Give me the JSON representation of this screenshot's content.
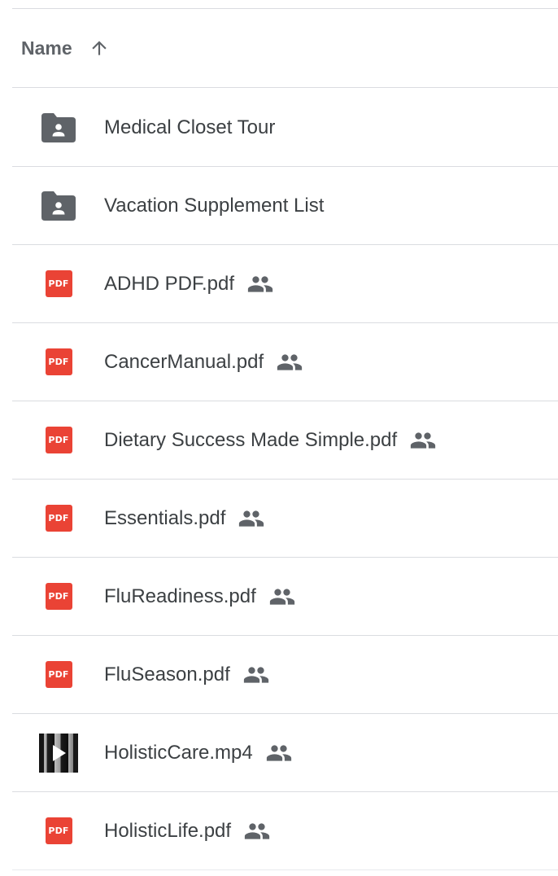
{
  "header": {
    "name_label": "Name",
    "sort_icon": "arrow-up-icon"
  },
  "files": [
    {
      "name": "Medical Closet Tour",
      "type": "shared-folder",
      "icon": "shared-folder-icon",
      "shared": false
    },
    {
      "name": "Vacation Supplement List",
      "type": "shared-folder",
      "icon": "shared-folder-icon",
      "shared": false
    },
    {
      "name": "ADHD PDF.pdf",
      "type": "pdf",
      "icon": "pdf-icon",
      "icon_text": "PDF",
      "shared": true
    },
    {
      "name": "CancerManual.pdf",
      "type": "pdf",
      "icon": "pdf-icon",
      "icon_text": "PDF",
      "shared": true
    },
    {
      "name": "Dietary Success Made Simple.pdf",
      "type": "pdf",
      "icon": "pdf-icon",
      "icon_text": "PDF",
      "shared": true
    },
    {
      "name": "Essentials.pdf",
      "type": "pdf",
      "icon": "pdf-icon",
      "icon_text": "PDF",
      "shared": true
    },
    {
      "name": "FluReadiness.pdf",
      "type": "pdf",
      "icon": "pdf-icon",
      "icon_text": "PDF",
      "shared": true
    },
    {
      "name": "FluSeason.pdf",
      "type": "pdf",
      "icon": "pdf-icon",
      "icon_text": "PDF",
      "shared": true
    },
    {
      "name": "HolisticCare.mp4",
      "type": "video",
      "icon": "video-thumbnail-icon",
      "shared": true
    },
    {
      "name": "HolisticLife.pdf",
      "type": "pdf",
      "icon": "pdf-icon",
      "icon_text": "PDF",
      "shared": true
    }
  ],
  "colors": {
    "pdf_red": "#ea4335",
    "folder_gray": "#5f6368",
    "divider": "#dadce0",
    "text": "#3c4043"
  }
}
